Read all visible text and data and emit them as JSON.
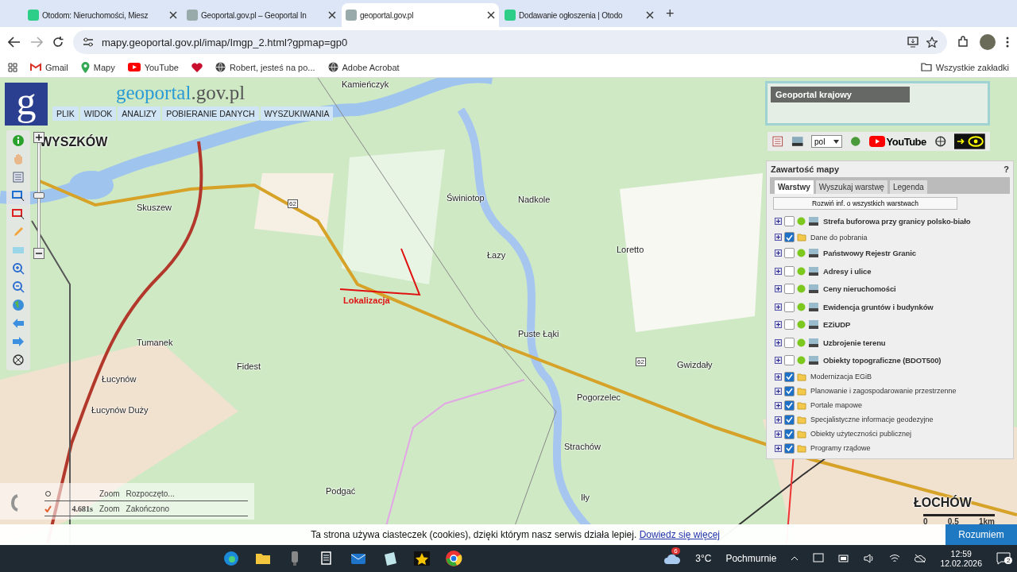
{
  "browser": {
    "tabs": [
      {
        "title": "Otodom: Nieruchomości, Miesz",
        "selected": false,
        "kind": "otodom"
      },
      {
        "title": "Geoportal.gov.pl – Geoportal In",
        "selected": false,
        "kind": "geoportal"
      },
      {
        "title": "geoportal.gov.pl",
        "selected": true,
        "kind": "geoportal"
      },
      {
        "title": "Dodawanie ogłoszenia | Otodo",
        "selected": false,
        "kind": "otodom"
      }
    ],
    "new_tab": "+",
    "address": "mapy.geoportal.gov.pl/imap/Imgp_2.html?gpmap=gp0",
    "bookmarks": [
      {
        "label": "Gmail",
        "kind": "gmail"
      },
      {
        "label": "Mapy",
        "kind": "maps"
      },
      {
        "label": "YouTube",
        "kind": "youtube"
      },
      {
        "kind": "heart"
      },
      {
        "label": "Robert, jesteś na po...",
        "kind": "globe"
      },
      {
        "label": "Adobe Acrobat",
        "kind": "globe"
      }
    ],
    "all_bookmarks": "Wszystkie zakładki"
  },
  "header": {
    "logo_letter": "g",
    "site_name": "geoportal",
    "site_suffix": ".gov.pl",
    "menu": [
      "PLIK",
      "WIDOK",
      "ANALIZY",
      "POBIERANIE DANYCH",
      "WYSZUKIWANIA"
    ]
  },
  "map": {
    "labels": [
      {
        "text": "WYSZKÓW",
        "kind": "city"
      },
      {
        "text": "Kamieńczyk",
        "kind": "place"
      },
      {
        "text": "Skuszew",
        "kind": "place"
      },
      {
        "text": "Tumanek",
        "kind": "place"
      },
      {
        "text": "Łucynów",
        "kind": "place"
      },
      {
        "text": "Łucynów Duży",
        "kind": "place"
      },
      {
        "text": "Fidest",
        "kind": "place"
      },
      {
        "text": "Świniotop",
        "kind": "place"
      },
      {
        "text": "Nadkole",
        "kind": "place"
      },
      {
        "text": "Loretto",
        "kind": "place"
      },
      {
        "text": "Łazy",
        "kind": "place"
      },
      {
        "text": "Puste Łąki",
        "kind": "place"
      },
      {
        "text": "Gwizdały",
        "kind": "place"
      },
      {
        "text": "Pogorzelec",
        "kind": "place"
      },
      {
        "text": "Strachów",
        "kind": "place"
      },
      {
        "text": "Podgać",
        "kind": "place"
      },
      {
        "text": "Iły",
        "kind": "place"
      },
      {
        "text": "Lokalizacja",
        "kind": "marker"
      },
      {
        "text": "62",
        "kind": "road"
      },
      {
        "text": "62",
        "kind": "road"
      },
      {
        "text": "ŁOCHÓW",
        "kind": "city"
      }
    ],
    "scale": [
      "0",
      "0.5",
      "1km"
    ],
    "zoom_slider": {
      "level": 0.5
    }
  },
  "log": [
    {
      "action": "Zoom",
      "status": "Rozpoczęto...",
      "done": false
    },
    {
      "time": "4.681s",
      "action": "Zoom",
      "status": "Zakończono",
      "done": true
    }
  ],
  "overview": {
    "title": "Geoportal krajowy"
  },
  "toolbar": {
    "language": "pol",
    "youtube": "YouTube"
  },
  "layers_panel": {
    "title": "Zawartość mapy",
    "help": "?",
    "tabs": [
      {
        "label": "Warstwy",
        "selected": true
      },
      {
        "label": "Wyszukaj warstwę",
        "selected": false
      },
      {
        "label": "Legenda",
        "selected": false
      }
    ],
    "expand_button": "Rozwiń inf. o wszystkich warstwach",
    "layers": [
      {
        "name": "Strefa buforowa przy granicy polsko-biało",
        "kind": "service",
        "checked": false
      },
      {
        "name": "Dane do pobrania",
        "kind": "folder",
        "checked": true
      },
      {
        "name": "Państwowy Rejestr Granic",
        "kind": "service",
        "checked": false
      },
      {
        "name": "Adresy i ulice",
        "kind": "service",
        "checked": false
      },
      {
        "name": "Ceny nieruchomości",
        "kind": "service",
        "checked": false
      },
      {
        "name": "Ewidencja gruntów i budynków",
        "kind": "service",
        "checked": false
      },
      {
        "name": "EZiUDP",
        "kind": "service",
        "checked": false
      },
      {
        "name": "Uzbrojenie terenu",
        "kind": "service",
        "checked": false
      },
      {
        "name": "Obiekty topograficzne (BDOT500)",
        "kind": "service",
        "checked": false
      },
      {
        "name": "Modernizacja EGiB",
        "kind": "folder",
        "checked": true
      },
      {
        "name": "Planowanie i zagospodarowanie przestrzenne",
        "kind": "folder",
        "checked": true
      },
      {
        "name": "Portale mapowe",
        "kind": "folder",
        "checked": true
      },
      {
        "name": "Specjalistyczne informacje geodezyjne",
        "kind": "folder",
        "checked": true
      },
      {
        "name": "Obiekty użyteczności publicznej",
        "kind": "folder",
        "checked": true
      },
      {
        "name": "Programy rządowe",
        "kind": "folder",
        "checked": true
      }
    ]
  },
  "cookie_bar": {
    "text": "Ta strona używa ciasteczek (cookies), dzięki którym nasz serwis działa lepiej.",
    "link": "Dowiedz się więcej",
    "button": "Rozumiem"
  },
  "taskbar": {
    "weather_badge": "6",
    "temperature": "3°C",
    "weather": "Pochmurnie",
    "time": "12:59",
    "date": "12.02.2026",
    "notifications": "2"
  }
}
